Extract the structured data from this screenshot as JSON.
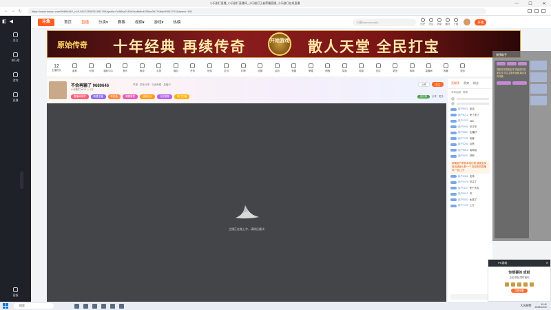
{
  "browser": {
    "window_title": "小乐剧打直播_小乐剧打直播间_小乐剧打王者荣耀直播_小乐剧打在线直播",
    "url": "https://www.douyu.com/9680646?_rt=0.8517285525195179&dyshid=0c58aa2-84b1ba8b8c4505ad061748ab00051701&dyshci=181",
    "win_minimize": "—",
    "win_maximize": "☐",
    "win_close": "✕"
  },
  "sidebar": {
    "items": [
      {
        "label": "关注"
      },
      {
        "label": "排行榜"
      },
      {
        "label": "游戏"
      },
      {
        "label": "直播"
      }
    ],
    "bottom_label": "客服"
  },
  "site": {
    "logo": "斗鱼",
    "nav": [
      {
        "label": "首页"
      },
      {
        "label": "直播"
      },
      {
        "label": "分类▾"
      },
      {
        "label": "赛事"
      },
      {
        "label": "视频▾"
      },
      {
        "label": "游戏▾"
      },
      {
        "label": "热榜"
      }
    ],
    "search_placeholder": "小狐flawmoney86",
    "header_icons": [
      {
        "label": "历史"
      },
      {
        "label": "关注"
      },
      {
        "label": "消息"
      },
      {
        "label": "福利"
      },
      {
        "label": "下载"
      }
    ],
    "live_button": "开播"
  },
  "banner": {
    "left_text": "原始传奇",
    "main_text": "十年经典 再续传奇",
    "seal_text": "开始游戏",
    "right_text": "散人天堂 全民打宝"
  },
  "toolbar": {
    "fans_count": "12",
    "fans_label": "主播粉丝",
    "items": [
      {
        "label": "道具"
      },
      {
        "label": "分推"
      },
      {
        "label": "福利中心"
      },
      {
        "label": "音乐"
      },
      {
        "label": "闹钟"
      },
      {
        "label": "礼物"
      },
      {
        "label": "福包"
      },
      {
        "label": "任务"
      },
      {
        "label": "优惠"
      },
      {
        "label": "红包"
      },
      {
        "label": "灯牌"
      },
      {
        "label": "设置"
      },
      {
        "label": "活动"
      },
      {
        "label": "宝箱"
      },
      {
        "label": "荣耀"
      },
      {
        "label": "储值"
      },
      {
        "label": "奖励"
      },
      {
        "label": "抽奖"
      },
      {
        "label": "社区"
      },
      {
        "label": "更多"
      },
      {
        "label": "商城"
      },
      {
        "label": "直播间"
      },
      {
        "label": "收藏"
      },
      {
        "label": "更多"
      }
    ]
  },
  "anchor": {
    "name": "不会再输了 9680646",
    "meta": "小乐剧打  ♥ 10  ☆ 1万",
    "sub": "举报  ·  更多分享 · 王者荣耀 · 直播中",
    "tags": [
      {
        "label": "直播间荣誉",
        "color": "#ff5d7a"
      },
      {
        "label": "新晋主播",
        "color": "#8c6cf0"
      },
      {
        "label": "车友会",
        "color": "#ff8a3d"
      },
      {
        "label": "荣耀荣誉",
        "color": "#e65bb5"
      },
      {
        "label": "活动达人",
        "color": "#ff9f1a"
      },
      {
        "label": "分区推荐",
        "color": "#b565e8"
      },
      {
        "label": "热门主播",
        "color": "#ffb300"
      }
    ],
    "right_pills": [
      "分享",
      "关注"
    ],
    "right_meta": [
      "送礼物",
      "分享",
      "更多"
    ]
  },
  "player": {
    "loading_text": "主播正在路上中，请稍后重试"
  },
  "right_panel": {
    "tabs": [
      "贡献榜",
      "贵宾",
      "粉丝"
    ],
    "title": "本场贡献 · 周榜",
    "chat": [
      {
        "name": "用户8923",
        "text": "加油"
      },
      {
        "name": "用户8712",
        "text": "来了来了"
      },
      {
        "name": "用户1223",
        "text": "666"
      },
      {
        "name": "用户0934",
        "text": "冲冲冲"
      },
      {
        "name": "用户5567",
        "text": "主播好"
      },
      {
        "name": "用户7781",
        "text": "厉害"
      },
      {
        "name": "用户2293",
        "text": "点赞"
      },
      {
        "name": "用户6612",
        "text": "哈哈哈"
      },
      {
        "name": "用户0042",
        "text": "好耶"
      },
      {
        "name": "用户3301",
        "text": "支持"
      },
      {
        "name": "用户4478",
        "text": "关注了"
      },
      {
        "name": "用户1187",
        "text": "来个大招"
      },
      {
        "name": "用户9012",
        "text": "冲"
      },
      {
        "name": "用户5533",
        "text": "太强了"
      },
      {
        "name": "用户7720",
        "text": "上分"
      }
    ],
    "gift_text": "恭喜用户荣获本场礼物 感谢支持 送出超级火箭一个 欢迎来到直播间 一起上分"
  },
  "overlay": {
    "header": "排榜助手",
    "text": "感谢支持感谢支持 感谢支持感谢支持 关注主播不迷路 每日准时开播"
  },
  "adcard": {
    "header": "PK游戏",
    "title": "你想要的 成就",
    "subtitle": "点击领取 限时福利",
    "button": "立即领取"
  },
  "taskbar": {
    "search": "搜索",
    "weather": "大风预警",
    "time": "19:41",
    "date": "2025/12/31"
  },
  "colors": {
    "brand": "#ff5d23",
    "sidebar": "#1e2228",
    "player_bg": "#444549"
  }
}
